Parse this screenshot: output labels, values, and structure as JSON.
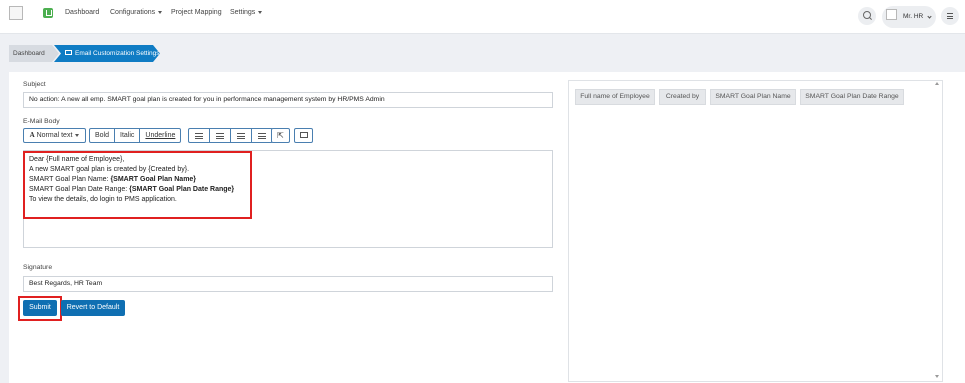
{
  "header": {
    "nav": {
      "dashboard": "Dashboard",
      "configurations": "Configurations",
      "project_mapping": "Project Mapping",
      "settings": "Settings"
    },
    "user_name": "Mr. HR"
  },
  "breadcrumb": {
    "home": "Dashboard",
    "current": "Email Customization Settings"
  },
  "form": {
    "subject_label": "Subject",
    "subject_value": "No action: A new all emp. SMART goal plan is created for you in performance management system by HR/PMS Admin",
    "body_label": "E-Mail Body",
    "toolbar": {
      "normal_text": "Normal text",
      "bold": "Bold",
      "italic": "Italic",
      "underline": "Underline"
    },
    "body_lines": {
      "line1": "Dear {Full name of Employee},",
      "line2": "A new SMART goal plan is created by {Created by}.",
      "line3_label": "SMART Goal Plan Name:",
      "line3_value": "{SMART Goal Plan Name}",
      "line4_label": "SMART Goal Plan Date Range:",
      "line4_value": "{SMART Goal Plan Date Range}",
      "line5": "To view the details, do login to PMS application."
    },
    "signature_label": "Signature",
    "signature_value": "Best Regards, HR Team",
    "submit_label": "Submit",
    "revert_label": "Revert to Default"
  },
  "placeholders": {
    "chips": [
      "Full name of Employee",
      "Created by",
      "SMART Goal Plan Name",
      "SMART Goal Plan Date Range"
    ]
  },
  "colors": {
    "accent": "#0f7cc4",
    "highlight": "#e02020"
  }
}
